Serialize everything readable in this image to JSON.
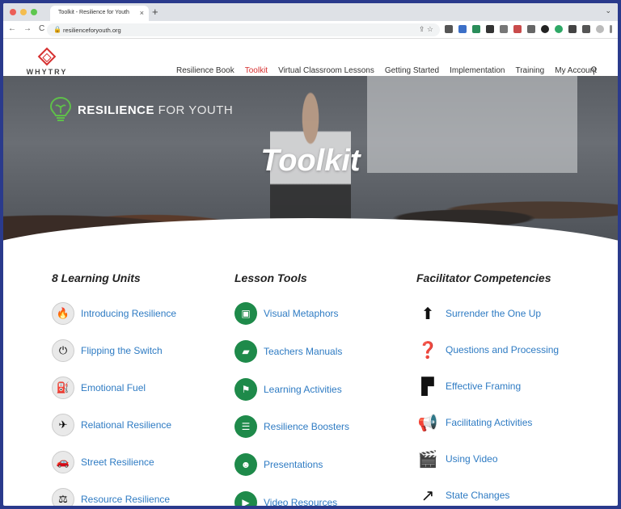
{
  "browser": {
    "tab_title": "Toolkit - Resilience for Youth",
    "tab_close": "×",
    "new_tab": "+",
    "tab_menu": "⌄",
    "url": "resilienceforyouth.org",
    "nav_buttons": [
      "←",
      "→",
      "C"
    ],
    "omni_icons": "⇪ ☆"
  },
  "site": {
    "logo_text": "WHYTRY",
    "nav": [
      "Resilience Book",
      "Toolkit",
      "Virtual Classroom Lessons",
      "Getting Started",
      "Implementation",
      "Training",
      "My Account"
    ],
    "active_nav": "Toolkit",
    "accent_color": "#d62f2f",
    "link_color": "#2e7bc3"
  },
  "hero": {
    "brand_bold": "RESILIENCE",
    "brand_light": " FOR YOUTH",
    "title": "Toolkit"
  },
  "columns": [
    {
      "heading": "8 Learning Units",
      "items": [
        {
          "label": "Introducing Resilience",
          "icon": "fire-icon"
        },
        {
          "label": "Flipping the Switch",
          "icon": "switch-icon"
        },
        {
          "label": "Emotional Fuel",
          "icon": "fuel-icon"
        },
        {
          "label": "Relational Resilience",
          "icon": "relational-icon"
        },
        {
          "label": "Street Resilience",
          "icon": "car-icon"
        },
        {
          "label": "Resource Resilience",
          "icon": "resource-icon"
        }
      ]
    },
    {
      "heading": "Lesson Tools",
      "items": [
        {
          "label": "Visual Metaphors",
          "icon": "presentation-icon"
        },
        {
          "label": "Teachers Manuals",
          "icon": "book-icon"
        },
        {
          "label": "Learning Activities",
          "icon": "flag-icon"
        },
        {
          "label": "Resilience Boosters",
          "icon": "clipboard-icon"
        },
        {
          "label": "Presentations",
          "icon": "presenter-icon"
        },
        {
          "label": "Video Resources",
          "icon": "video-icon"
        }
      ]
    },
    {
      "heading": "Facilitator Competencies",
      "items": [
        {
          "label": "Surrender the One Up",
          "icon": "arrow-up-icon"
        },
        {
          "label": "Questions and Processing",
          "icon": "question-icon"
        },
        {
          "label": "Effective Framing",
          "icon": "frame-icon"
        },
        {
          "label": "Facilitating Activities",
          "icon": "megaphone-icon"
        },
        {
          "label": "Using Video",
          "icon": "camera-icon"
        },
        {
          "label": "State Changes",
          "icon": "external-arrow-icon"
        }
      ]
    }
  ]
}
